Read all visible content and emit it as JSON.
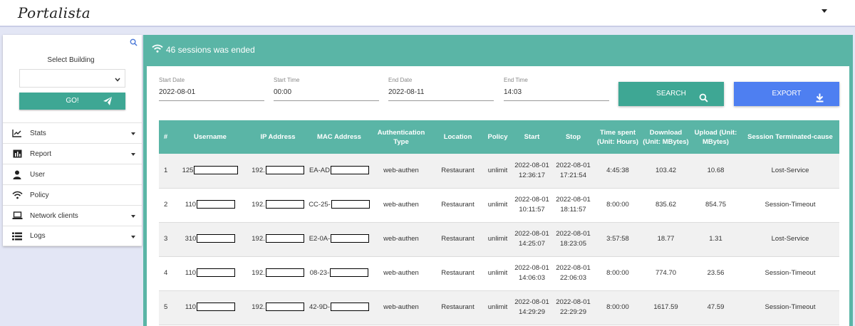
{
  "app": {
    "logo": "Portalista"
  },
  "sidebar": {
    "select_label": "Select Building",
    "select_value": "",
    "go_label": "GO!",
    "items": [
      {
        "label": "Stats",
        "icon": "line-chart-icon",
        "dropdown": true
      },
      {
        "label": "Report",
        "icon": "bar-chart-icon",
        "dropdown": true
      },
      {
        "label": "User",
        "icon": "user-icon",
        "dropdown": false
      },
      {
        "label": "Policy",
        "icon": "wifi-icon",
        "dropdown": false
      },
      {
        "label": "Network clients",
        "icon": "laptop-icon",
        "dropdown": true
      },
      {
        "label": "Logs",
        "icon": "list-icon",
        "dropdown": true
      }
    ]
  },
  "main": {
    "title": "46 sessions was ended",
    "filters": {
      "start_date": {
        "label": "Start Date",
        "value": "2022-08-01"
      },
      "start_time": {
        "label": "Start Time",
        "value": "00:00"
      },
      "end_date": {
        "label": "End Date",
        "value": "2022-08-11"
      },
      "end_time": {
        "label": "End Time",
        "value": "14:03"
      }
    },
    "search_label": "SEARCH",
    "export_label": "EXPORT",
    "table": {
      "headers": [
        "#",
        "Username",
        "IP Address",
        "MAC Address",
        "Authentication Type",
        "Location",
        "Policy",
        "Start",
        "Stop",
        "Time spent (Unit: Hours)",
        "Download (Unit: MBytes)",
        "Upload (Unit: MBytes)",
        "Session Terminated-cause"
      ],
      "rows": [
        {
          "num": "1",
          "username": "125",
          "ip": "192.",
          "mac": "EA-AD",
          "auth": "web-authen",
          "location": "Restaurant",
          "policy": "unlimit",
          "start_date": "2022-08-01",
          "start_time": "12:36:17",
          "stop_date": "2022-08-01",
          "stop_time": "17:21:54",
          "time_spent": "4:45:38",
          "download": "103.42",
          "upload": "10.68",
          "cause": "Lost-Service"
        },
        {
          "num": "2",
          "username": "110",
          "ip": "192.",
          "mac": "CC-25-",
          "auth": "web-authen",
          "location": "Restaurant",
          "policy": "unlimit",
          "start_date": "2022-08-01",
          "start_time": "10:11:57",
          "stop_date": "2022-08-01",
          "stop_time": "18:11:57",
          "time_spent": "8:00:00",
          "download": "835.62",
          "upload": "854.75",
          "cause": "Session-Timeout"
        },
        {
          "num": "3",
          "username": "310",
          "ip": "192.",
          "mac": "E2-0A-",
          "auth": "web-authen",
          "location": "Restaurant",
          "policy": "unlimit",
          "start_date": "2022-08-01",
          "start_time": "14:25:07",
          "stop_date": "2022-08-01",
          "stop_time": "18:23:05",
          "time_spent": "3:57:58",
          "download": "18.77",
          "upload": "1.31",
          "cause": "Lost-Service"
        },
        {
          "num": "4",
          "username": "110",
          "ip": "192.",
          "mac": "08-23-",
          "auth": "web-authen",
          "location": "Restaurant",
          "policy": "unlimit",
          "start_date": "2022-08-01",
          "start_time": "14:06:03",
          "stop_date": "2022-08-01",
          "stop_time": "22:06:03",
          "time_spent": "8:00:00",
          "download": "774.70",
          "upload": "23.56",
          "cause": "Session-Timeout"
        },
        {
          "num": "5",
          "username": "110",
          "ip": "192.",
          "mac": "42-9D-",
          "auth": "web-authen",
          "location": "Restaurant",
          "policy": "unlimit",
          "start_date": "2022-08-01",
          "start_time": "14:29:29",
          "stop_date": "2022-08-01",
          "stop_time": "22:29:29",
          "time_spent": "8:00:00",
          "download": "1617.59",
          "upload": "47.59",
          "cause": "Session-Timeout"
        }
      ]
    }
  },
  "colors": {
    "teal": "#5ab5a6",
    "button_teal": "#3ea794",
    "export_blue": "#4e7ff1",
    "page_bg": "#e3e6f5"
  }
}
